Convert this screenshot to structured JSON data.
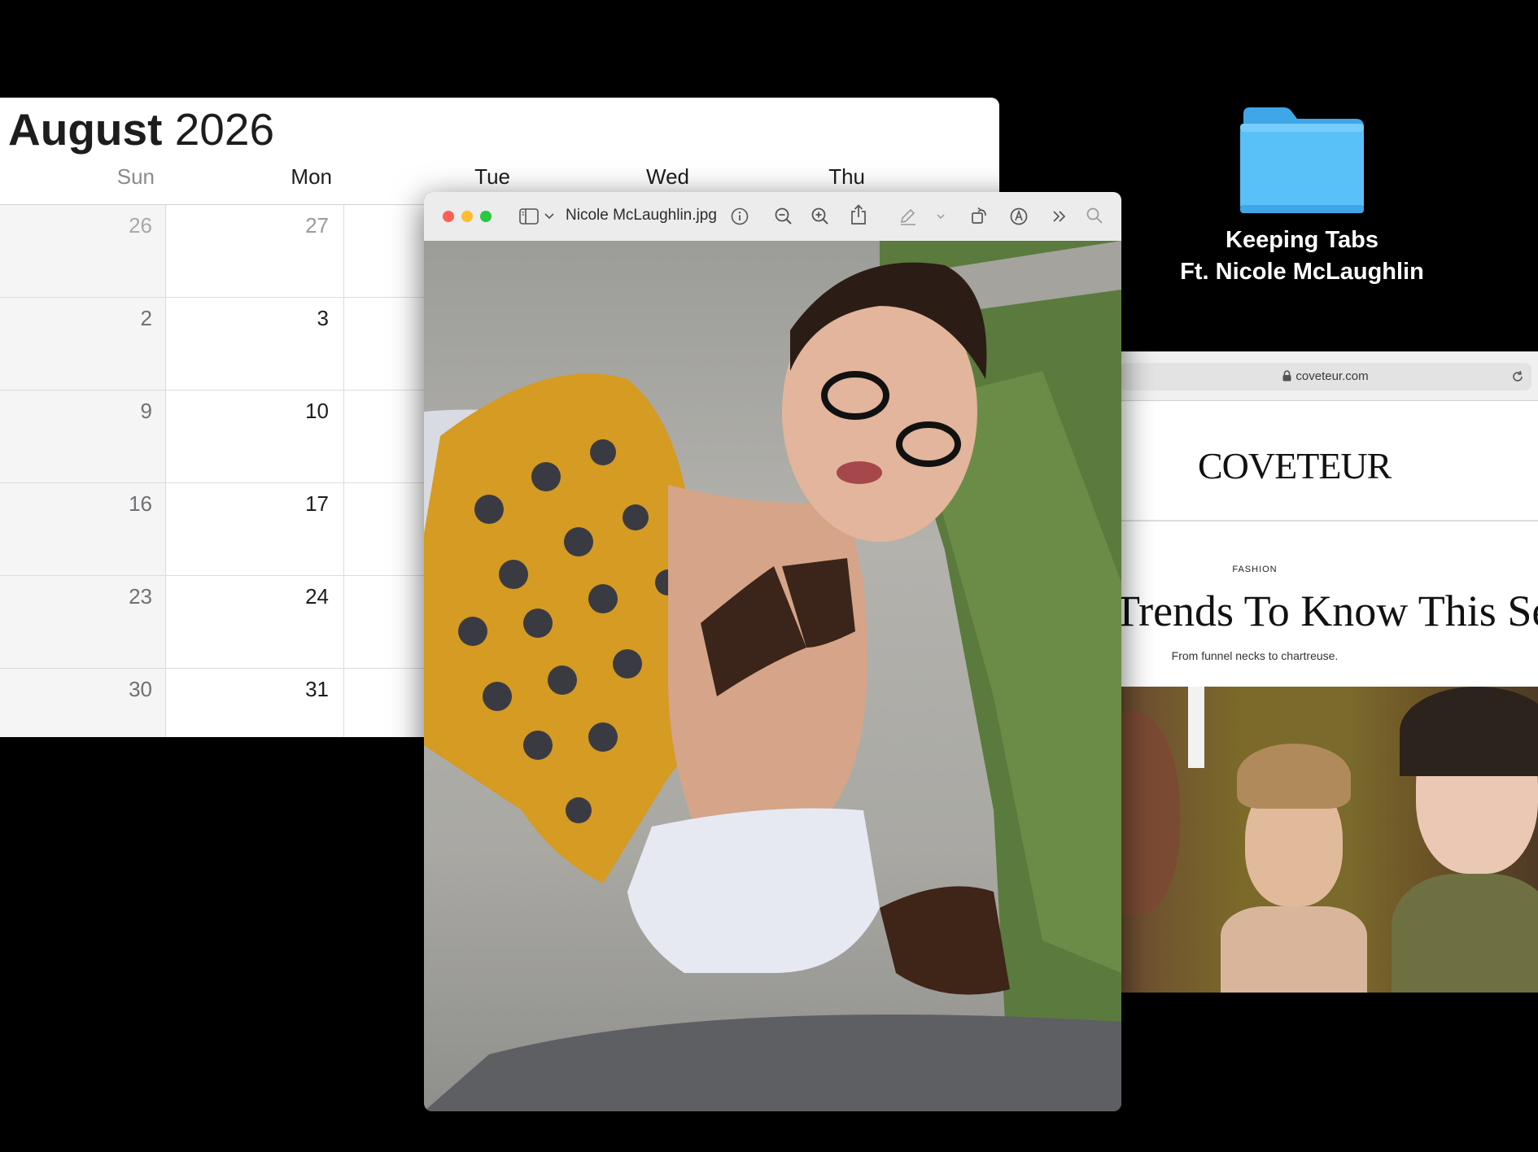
{
  "calendar": {
    "month": "August",
    "year": "2026",
    "weekdays": [
      "Sun",
      "Mon",
      "Tue",
      "Wed",
      "Thu"
    ],
    "weeks": [
      {
        "sun": "26",
        "mon": "27"
      },
      {
        "sun": "2",
        "mon": "3"
      },
      {
        "sun": "9",
        "mon": "10"
      },
      {
        "sun": "16",
        "mon": "17"
      },
      {
        "sun": "23",
        "mon": "24"
      },
      {
        "sun": "30",
        "mon": "31"
      }
    ]
  },
  "folder": {
    "line1": "Keeping Tabs",
    "line2": "Ft.  Nicole McLaughlin",
    "icon": "folder-icon",
    "color": "#5ac0f8"
  },
  "preview": {
    "filename": "Nicole McLaughlin.jpg",
    "toolbar_icons": [
      "sidebar-icon",
      "chevron-down-icon",
      "info-icon",
      "zoom-out-icon",
      "zoom-in-icon",
      "share-icon",
      "markup-pen-icon",
      "chevron-down-icon",
      "rotate-icon",
      "annotate-icon",
      "more-icon",
      "search-icon"
    ]
  },
  "browser": {
    "url": "coveteur.com",
    "logo": "COVETEUR",
    "category": "FASHION",
    "headline": "Trends To Know This Se",
    "subhead": "From funnel necks to chartreuse."
  }
}
